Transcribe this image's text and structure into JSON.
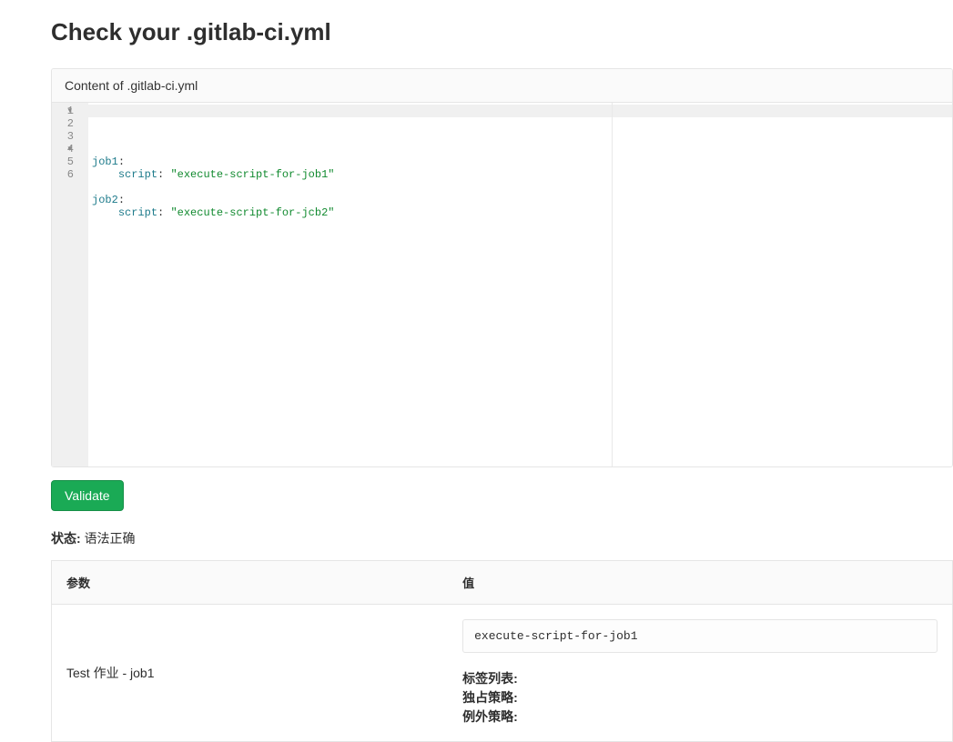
{
  "page": {
    "title": "Check your .gitlab-ci.yml"
  },
  "panel": {
    "header": "Content of .gitlab-ci.yml",
    "code_lines": [
      {
        "n": 1,
        "fold": true,
        "tokens": [
          [
            "key",
            "job1"
          ],
          [
            "plain",
            ":"
          ]
        ]
      },
      {
        "n": 2,
        "fold": false,
        "tokens": [
          [
            "plain",
            "    "
          ],
          [
            "key",
            "script"
          ],
          [
            "plain",
            ": "
          ],
          [
            "str",
            "\"execute-script-for-job1\""
          ]
        ]
      },
      {
        "n": 3,
        "fold": false,
        "tokens": []
      },
      {
        "n": 4,
        "fold": true,
        "tokens": [
          [
            "key",
            "job2"
          ],
          [
            "plain",
            ":"
          ]
        ]
      },
      {
        "n": 5,
        "fold": false,
        "tokens": [
          [
            "plain",
            "    "
          ],
          [
            "key",
            "script"
          ],
          [
            "plain",
            ": "
          ],
          [
            "str",
            "\"execute-script-for-jcb2\""
          ]
        ]
      },
      {
        "n": 6,
        "fold": false,
        "tokens": []
      }
    ]
  },
  "validate": {
    "button_label": "Validate"
  },
  "status": {
    "label": "状态:",
    "value": "语法正确"
  },
  "table": {
    "col_param": "参数",
    "col_value": "值",
    "rows": [
      {
        "param": "Test 作业 - job1",
        "script": "execute-script-for-job1",
        "lines": [
          "标签列表:",
          "独占策略:",
          "例外策略:"
        ]
      }
    ]
  }
}
